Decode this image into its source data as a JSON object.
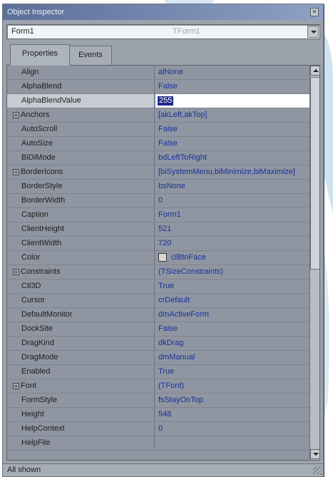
{
  "window": {
    "title": "Object Inspector"
  },
  "selector": {
    "object_name": "Form1",
    "object_type": "TForm1"
  },
  "tabs": [
    {
      "label": "Properties",
      "active": true
    },
    {
      "label": "Events",
      "active": false
    }
  ],
  "properties": [
    {
      "name": "Align",
      "value": "alNone"
    },
    {
      "name": "AlphaBlend",
      "value": "False"
    },
    {
      "name": "AlphaBlendValue",
      "value": "255",
      "editing": true
    },
    {
      "name": "Anchors",
      "value": "[akLeft,akTop]",
      "expander": "⊞"
    },
    {
      "name": "AutoScroll",
      "value": "False"
    },
    {
      "name": "AutoSize",
      "value": "False"
    },
    {
      "name": "BiDiMode",
      "value": "bdLeftToRight"
    },
    {
      "name": "BorderIcons",
      "value": "[biSystemMenu,biMinimize,biMaximize]",
      "expander": "⊞"
    },
    {
      "name": "BorderStyle",
      "value": "bsNone"
    },
    {
      "name": "BorderWidth",
      "value": "0"
    },
    {
      "name": "Caption",
      "value": "Form1"
    },
    {
      "name": "ClientHeight",
      "value": "521"
    },
    {
      "name": "ClientWidth",
      "value": "720"
    },
    {
      "name": "Color",
      "value": "clBtnFace",
      "swatch": true
    },
    {
      "name": "Constraints",
      "value": "(TSizeConstraints)",
      "expander": "⊞"
    },
    {
      "name": "Ctl3D",
      "value": "True"
    },
    {
      "name": "Cursor",
      "value": "crDefault"
    },
    {
      "name": "DefaultMonitor",
      "value": "dmActiveForm"
    },
    {
      "name": "DockSite",
      "value": "False"
    },
    {
      "name": "DragKind",
      "value": "dkDrag"
    },
    {
      "name": "DragMode",
      "value": "dmManual"
    },
    {
      "name": "Enabled",
      "value": "True"
    },
    {
      "name": "Font",
      "value": "(TFont)",
      "expander": "⊞"
    },
    {
      "name": "FormStyle",
      "value": "fsStayOnTop"
    },
    {
      "name": "Height",
      "value": "548"
    },
    {
      "name": "HelpContext",
      "value": "0"
    },
    {
      "name": "HelpFile",
      "value": ""
    }
  ],
  "status": {
    "text": "All shown"
  },
  "icons": {
    "close": "close-icon",
    "dropdown": "chevron-down-icon",
    "scroll_up": "arrow-up-icon",
    "scroll_down": "arrow-down-icon"
  },
  "colors": {
    "title_start": "#5b6f98",
    "value_text": "#1a2f9a",
    "selection": "#1e2a8c"
  }
}
